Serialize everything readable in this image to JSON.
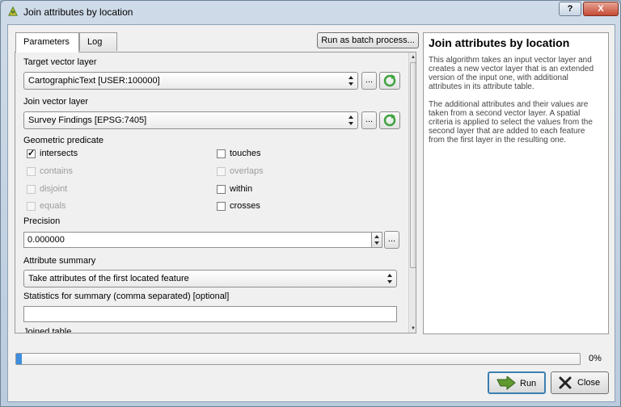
{
  "window": {
    "title": "Join attributes by location",
    "help_label": "?",
    "close_label": "X"
  },
  "tabs": [
    {
      "label": "Parameters"
    },
    {
      "label": "Log"
    }
  ],
  "batch_button": "Run as batch process...",
  "params": {
    "target_layer": {
      "label": "Target vector layer",
      "value": "CartographicText [USER:100000]"
    },
    "join_layer": {
      "label": "Join vector layer",
      "value": "Survey Findings [EPSG:7405]"
    },
    "predicate": {
      "label": "Geometric predicate",
      "items": [
        {
          "label": "intersects",
          "checked": true,
          "enabled": true
        },
        {
          "label": "touches",
          "checked": false,
          "enabled": true
        },
        {
          "label": "contains",
          "checked": false,
          "enabled": false
        },
        {
          "label": "overlaps",
          "checked": false,
          "enabled": false
        },
        {
          "label": "disjoint",
          "checked": false,
          "enabled": false
        },
        {
          "label": "within",
          "checked": false,
          "enabled": true
        },
        {
          "label": "equals",
          "checked": false,
          "enabled": false
        },
        {
          "label": "crosses",
          "checked": false,
          "enabled": true
        }
      ]
    },
    "precision": {
      "label": "Precision",
      "value": "0.000000"
    },
    "attribute_summary": {
      "label": "Attribute summary",
      "value": "Take attributes of the first located feature"
    },
    "statistics": {
      "label": "Statistics for summary (comma separated) [optional]",
      "value": ""
    },
    "joined_table": {
      "label": "Joined table"
    },
    "ellipsis": "..."
  },
  "help": {
    "title": "Join attributes by location",
    "para1": "This algorithm takes an input vector layer and creates a new vector layer that is an extended version of the input one, with additional attributes in its attribute table.",
    "para2": "The additional attributes and their values are taken from a second vector layer. A spatial criteria is applied to select the values from the second layer that are added to each feature from the first layer in the resulting one."
  },
  "progress": {
    "value": 0.01,
    "label": "0%"
  },
  "buttons": {
    "run": "Run",
    "close": "Close"
  },
  "colors": {
    "accent": "#3e8ede",
    "iterate_green": "#3fa33f",
    "run_arrow": "#5e9a2d",
    "close_x": "#222222"
  }
}
